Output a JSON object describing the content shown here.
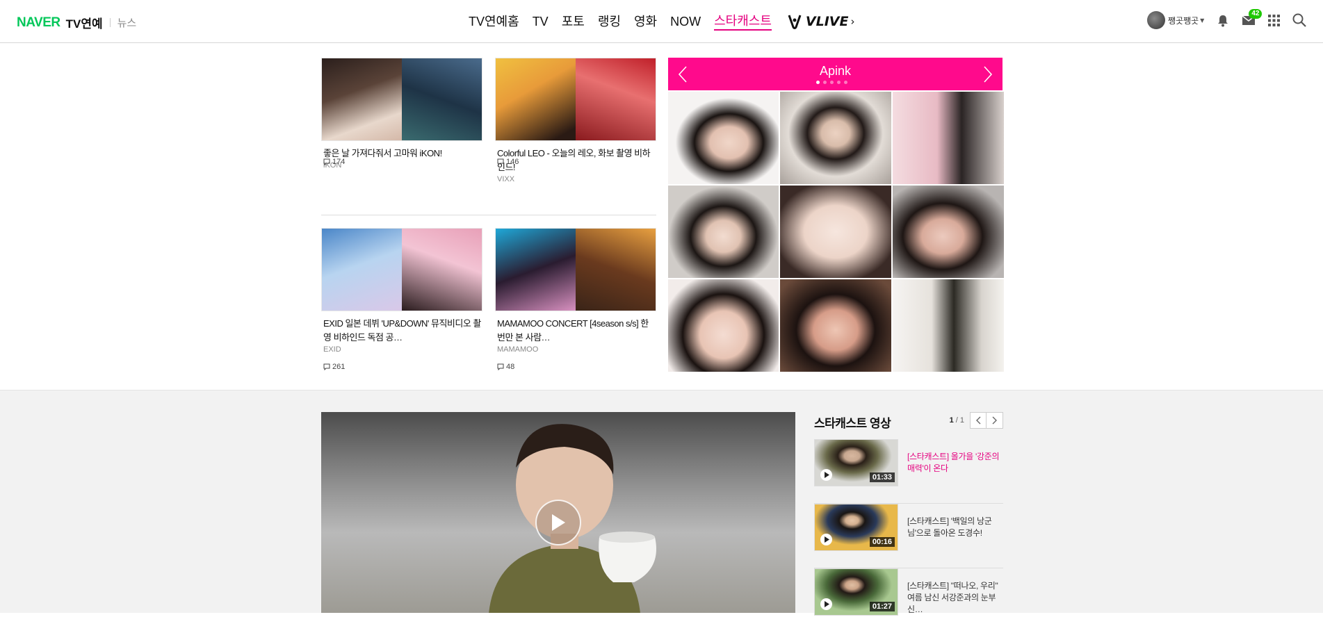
{
  "header": {
    "logo_brand": "NAVER",
    "logo_service": "TV연예",
    "logo_sub": "뉴스",
    "nav": [
      "TV연예홈",
      "TV",
      "포토",
      "랭킹",
      "영화",
      "NOW",
      "스타캐스트"
    ],
    "active_nav": "스타캐스트",
    "vlive_label": "VLIVE",
    "user_name": "쨍곳쨍곳",
    "mail_badge": "42"
  },
  "cards": [
    {
      "title": "좋은 날 가져다줘서 고마워 iKON!",
      "artist": "iKON",
      "comments": "174"
    },
    {
      "title": "Colorful LEO - 오늘의 레오, 화보 촬영 비하인드!",
      "artist": "VIXX",
      "comments": "146"
    },
    {
      "title": "EXID 일본 데뷔 'UP&DOWN' 뮤직비디오 촬영 비하인드 독점 공…",
      "artist": "EXID",
      "comments": "261"
    },
    {
      "title": "MAMAMOO CONCERT [4season s/s] 한번만 본 사람…",
      "artist": "MAMAMOO",
      "comments": "48"
    }
  ],
  "gallery": {
    "title": "Apink",
    "dots": 5,
    "active_dot": 0
  },
  "video_panel": {
    "title": "스타캐스트 영상",
    "page_current": "1",
    "page_total": "/ 1",
    "items": [
      {
        "title": "[스타캐스트] 올가을 '강준의 매력'이 온다",
        "duration": "01:33",
        "highlight": true
      },
      {
        "title": "[스타캐스트] '백일의 낭군님'으로 돌아온 도경수!",
        "duration": "00:16",
        "highlight": false
      },
      {
        "title": "[스타캐스트] \"떠나오, 우리\" 여름 남신 서강준과의 눈부신…",
        "duration": "01:27",
        "highlight": false
      }
    ]
  },
  "colors": {
    "naver_green": "#03c75a",
    "starcast_pink": "#ff0a8c",
    "active_link": "#e5007f"
  }
}
